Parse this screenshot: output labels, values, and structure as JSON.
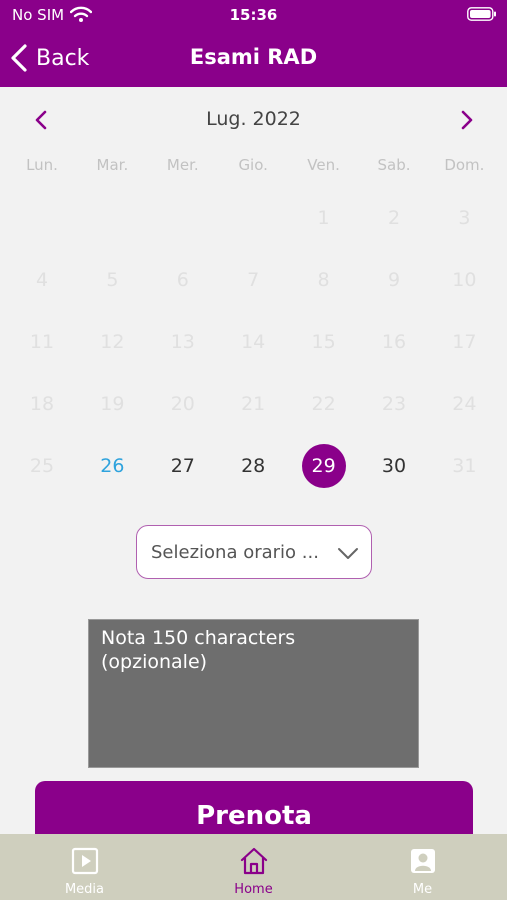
{
  "status": {
    "carrier": "No SIM",
    "time": "15:36"
  },
  "nav": {
    "back_label": "Back",
    "title": "Esami RAD"
  },
  "calendar": {
    "month_label": "Lug. 2022",
    "weekdays": [
      "Lun.",
      "Mar.",
      "Mer.",
      "Gio.",
      "Ven.",
      "Sab.",
      "Dom."
    ],
    "days": [
      [
        null,
        null,
        null,
        null,
        "1",
        "2",
        "3"
      ],
      [
        "4",
        "5",
        "6",
        "7",
        "8",
        "9",
        "10"
      ],
      [
        "11",
        "12",
        "13",
        "14",
        "15",
        "16",
        "17"
      ],
      [
        "18",
        "19",
        "20",
        "21",
        "22",
        "23",
        "24"
      ],
      [
        "25",
        "26",
        "27",
        "28",
        "29",
        "30",
        "31"
      ]
    ],
    "today": "26",
    "selected": "29",
    "available": [
      "26",
      "27",
      "28",
      "29",
      "30"
    ]
  },
  "time_select": {
    "placeholder": "Seleziona orario ..."
  },
  "note": {
    "placeholder": "Nota 150 characters (opzionale)"
  },
  "book_button": {
    "label": "Prenota"
  },
  "tabs": [
    {
      "label": "Media",
      "icon": "media-icon"
    },
    {
      "label": "Home",
      "icon": "home-icon",
      "current": true
    },
    {
      "label": "Me",
      "icon": "profile-icon"
    }
  ],
  "colors": {
    "brand": "#8a008a",
    "today": "#2fa3dd",
    "tabbar": "#cfcfbe"
  }
}
